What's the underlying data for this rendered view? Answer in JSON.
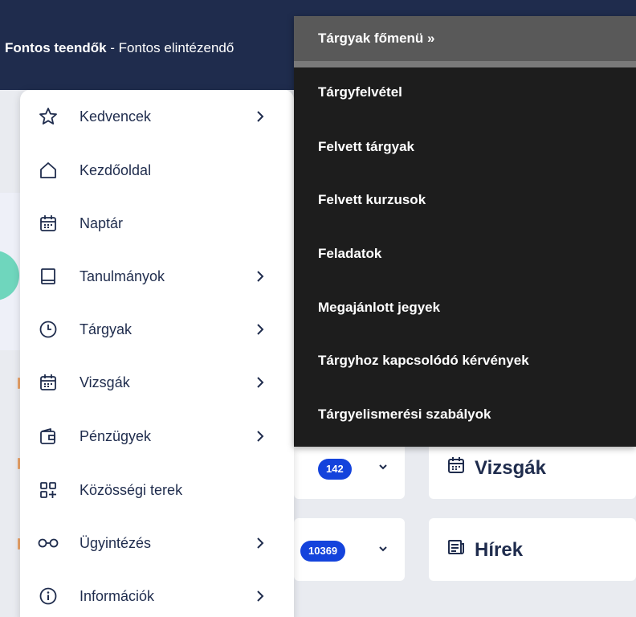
{
  "topbar": {
    "todo_bold": "Fontos teendők",
    "todo_rest": " - Fontos elintézendő"
  },
  "side_menu": {
    "items": [
      {
        "label": "Kedvencek",
        "icon": "star-icon",
        "has_submenu": true
      },
      {
        "label": "Kezdőoldal",
        "icon": "home-icon",
        "has_submenu": false
      },
      {
        "label": "Naptár",
        "icon": "calendar-icon",
        "has_submenu": false
      },
      {
        "label": "Tanulmányok",
        "icon": "book-icon",
        "has_submenu": true
      },
      {
        "label": "Tárgyak",
        "icon": "clock-icon",
        "has_submenu": true
      },
      {
        "label": "Vizsgák",
        "icon": "calendar-icon",
        "has_submenu": true
      },
      {
        "label": "Pénzügyek",
        "icon": "wallet-icon",
        "has_submenu": true
      },
      {
        "label": "Közösségi terek",
        "icon": "grid-plus-icon",
        "has_submenu": false
      },
      {
        "label": "Ügyintézés",
        "icon": "glasses-icon",
        "has_submenu": true
      },
      {
        "label": "Információk",
        "icon": "info-icon",
        "has_submenu": true
      }
    ]
  },
  "dropdown": {
    "header": "Tárgyak főmenü »",
    "items": [
      "Tárgyfelvétel",
      "Felvett tárgyak",
      "Felvett kurzusok",
      "Feladatok",
      "Megajánlott jegyek",
      "Tárgyhoz kapcsolódó kérvények",
      "Tárgyelismerési szabályok"
    ]
  },
  "tiles": {
    "vizsgak": {
      "badge": "142",
      "title": "Vizsgák"
    },
    "hirek": {
      "badge": "10369",
      "title": "Hírek"
    }
  },
  "colors": {
    "topbar": "#1f2c4d",
    "badge": "#1443dc",
    "dropdown_bg": "#1d1d1d",
    "dropdown_header": "#595959",
    "text_dark": "#1f2c4d"
  }
}
